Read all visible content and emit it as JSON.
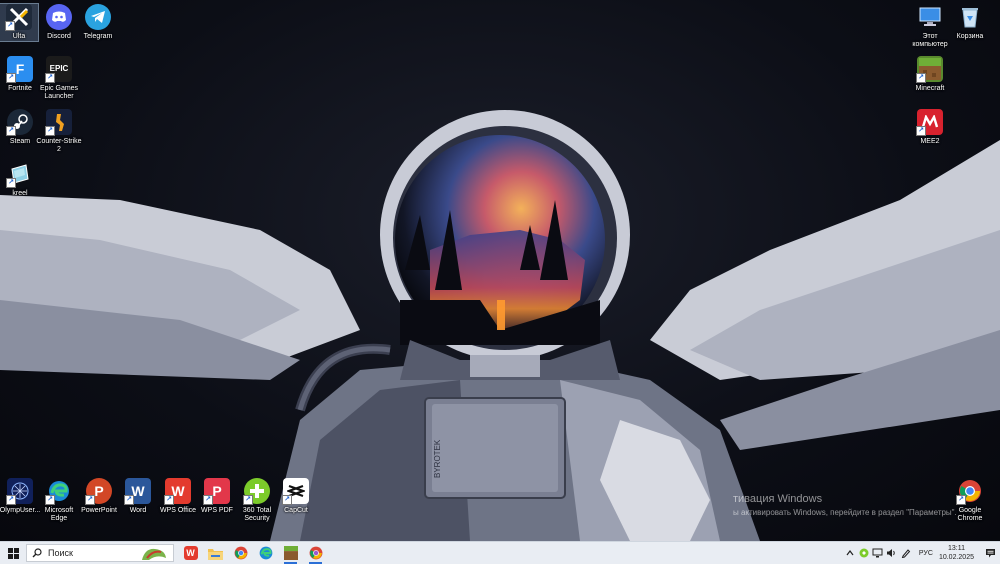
{
  "desktop": {
    "icons_left": [
      {
        "name": "ultra",
        "label": "Ulta",
        "icon": "ultra-x-icon",
        "color": "#1f2a3a"
      },
      {
        "name": "discord",
        "label": "Discord",
        "icon": "discord-icon",
        "color": "#5865f2"
      },
      {
        "name": "telegram",
        "label": "Telegram",
        "icon": "telegram-icon",
        "color": "#2aa3e0"
      },
      {
        "name": "fortnite",
        "label": "Fortnite",
        "icon": "fortnite-icon",
        "color": "#2b8ef0"
      },
      {
        "name": "epic-games",
        "label": "Epic Games Launcher",
        "icon": "epic-games-icon",
        "color": "#1b1b1b"
      },
      {
        "name": "steam",
        "label": "Steam",
        "icon": "steam-icon",
        "color": "#1b2838"
      },
      {
        "name": "counter-strike",
        "label": "Counter-Strike 2",
        "icon": "counter-strike-icon",
        "color": "#f0a020"
      },
      {
        "name": "kreel",
        "label": "kreel",
        "icon": "folder-file-icon",
        "color": "#8ed0e6"
      }
    ],
    "icons_right": [
      {
        "name": "this-pc",
        "label": "Этот компьютер",
        "icon": "computer-icon",
        "color": "#3a8ee6"
      },
      {
        "name": "recycle-bin",
        "label": "Корзина",
        "icon": "recycle-bin-icon",
        "color": "#cfe4f5"
      },
      {
        "name": "minecraft",
        "label": "Minecraft",
        "icon": "minecraft-icon",
        "color": "#5a8a2e"
      },
      {
        "name": "mee2",
        "label": "MEE2",
        "icon": "mee2-icon",
        "color": "#d8222e"
      }
    ],
    "icons_bottom": [
      {
        "name": "olymp",
        "label": "OlympUser...",
        "icon": "olymp-icon",
        "color": "#10205a"
      },
      {
        "name": "edge",
        "label": "Microsoft Edge",
        "icon": "edge-icon",
        "color": "#1a8ad6"
      },
      {
        "name": "powerpoint",
        "label": "PowerPoint",
        "icon": "powerpoint-icon",
        "color": "#d24726"
      },
      {
        "name": "word",
        "label": "Word",
        "icon": "word-icon",
        "color": "#2b579a"
      },
      {
        "name": "wps-office",
        "label": "WPS Office",
        "icon": "wps-office-icon",
        "color": "#e33b2e"
      },
      {
        "name": "wps-pdf",
        "label": "WPS PDF",
        "icon": "wps-pdf-icon",
        "color": "#e2374a"
      },
      {
        "name": "360-security",
        "label": "360 Total Security",
        "icon": "360-security-icon",
        "color": "#7ccb2b"
      },
      {
        "name": "capcut",
        "label": "CapCut",
        "icon": "capcut-icon",
        "color": "#111111"
      },
      {
        "name": "chrome",
        "label": "Google Chrome",
        "icon": "chrome-icon",
        "color": "#db4437"
      }
    ],
    "watermark": {
      "line1": "тивация Windows",
      "line2": "ы активировать Windows, перейдите в раздел \"Параметры\"."
    },
    "helmet_text": "BYROTEK"
  },
  "taskbar": {
    "search_placeholder": "Поиск",
    "apps": [
      {
        "name": "wps",
        "icon": "wps-icon",
        "color": "#e33b2e",
        "running": false
      },
      {
        "name": "explorer",
        "icon": "folder-icon",
        "color": "#f2c14e",
        "running": false
      },
      {
        "name": "chrome",
        "icon": "chrome-icon",
        "color": "#db4437",
        "running": false
      },
      {
        "name": "edge",
        "icon": "edge-icon",
        "color": "#1a8ad6",
        "running": false
      },
      {
        "name": "minecraft",
        "icon": "minecraft-icon",
        "color": "#5a8a2e",
        "running": true
      },
      {
        "name": "chrome-profile",
        "icon": "chrome-icon",
        "color": "#db4437",
        "running": true
      }
    ],
    "tray": {
      "lang": "РУС",
      "time": "13:11",
      "date": "10.02.2025"
    }
  }
}
